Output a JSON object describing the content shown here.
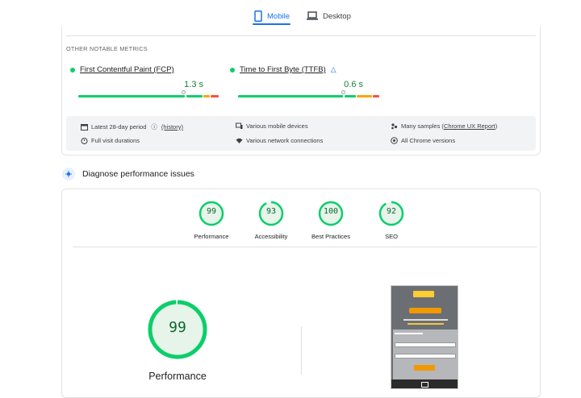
{
  "tabs": {
    "mobile": "Mobile",
    "desktop": "Desktop",
    "active": "mobile"
  },
  "notable": {
    "heading": "OTHER NOTABLE METRICS",
    "metrics": [
      {
        "name": "First Contentful Paint (FCP)",
        "value": "1.3 s",
        "status_color": "#0cce6b",
        "marker_fraction": 0.74
      },
      {
        "name": "Time to First Byte (TTFB)",
        "value": "0.6 s",
        "status_color": "#0cce6b",
        "marker_fraction": 0.75,
        "lab_icon": "flask-icon"
      }
    ]
  },
  "field_info": {
    "period": "Latest 28-day period",
    "history": "(history)",
    "devices": "Various mobile devices",
    "samples_prefix": "Many samples (",
    "samples_link": "Chrome UX Report",
    "samples_suffix": ")",
    "visits": "Full visit durations",
    "network": "Various network connections",
    "chrome": "All Chrome versions"
  },
  "diagnose": {
    "title": "Diagnose performance issues"
  },
  "scores": [
    {
      "value": "99",
      "label": "Performance",
      "fraction": 0.99
    },
    {
      "value": "93",
      "label": "Accessibility",
      "fraction": 0.93
    },
    {
      "value": "100",
      "label": "Best Practices",
      "fraction": 1.0
    },
    {
      "value": "92",
      "label": "SEO",
      "fraction": 0.92
    }
  ],
  "featured": {
    "value": "99",
    "label": "Performance",
    "fraction": 0.99
  },
  "colors": {
    "accent": "#1a73e8",
    "pass": "#0cce6b",
    "pass_text": "#0d652d",
    "average": "#ffa400",
    "fail": "#ff4e42"
  }
}
